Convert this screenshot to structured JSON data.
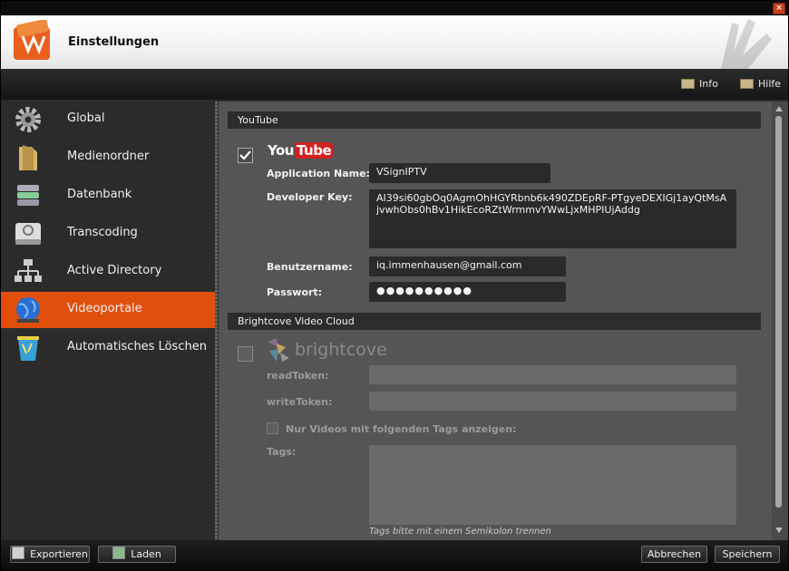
{
  "window": {
    "title": "Einstellungen",
    "close_glyph": "×"
  },
  "menu": {
    "info": "Info",
    "help": "Hilfe"
  },
  "sidebar": {
    "items": [
      {
        "label": "Global",
        "icon": "gear-icon"
      },
      {
        "label": "Medienordner",
        "icon": "folder-icon"
      },
      {
        "label": "Datenbank",
        "icon": "database-icon"
      },
      {
        "label": "Transcoding",
        "icon": "drive-icon"
      },
      {
        "label": "Active Directory",
        "icon": "network-icon"
      },
      {
        "label": "Videoportale",
        "icon": "globe-icon",
        "active": true
      },
      {
        "label": "Automatisches Löschen",
        "icon": "trash-icon"
      }
    ]
  },
  "youtube": {
    "section_title": "YouTube",
    "logo_you": "You",
    "logo_tube": "Tube",
    "enabled": true,
    "app_name_label": "Application Name:",
    "app_name_value": "VSignIPTV",
    "dev_key_label": "Developer Key:",
    "dev_key_value": "AI39si60gbOq0AgmOhHGYRbnb6k490ZDEpRF-PTgyeDEXIGj1ayQtMsAjvwhObs0hBv1HikEcoRZtWrmmvYWwLjxMHPIUjAddg",
    "username_label": "Benutzername:",
    "username_value": "iq.immenhausen@gmail.com",
    "password_label": "Passwort:",
    "password_value": "●●●●●●●●●●"
  },
  "brightcove": {
    "section_title": "Brightcove Video Cloud",
    "logo_text": "brightcove",
    "enabled": false,
    "read_token_label": "readToken:",
    "write_token_label": "writeToken:",
    "tags_filter_label": "Nur Videos mit folgenden Tags anzeigen:",
    "tags_label": "Tags:",
    "tags_hint": "Tags bitte mit einem Semikolon trennen"
  },
  "footer": {
    "export": "Exportieren",
    "load": "Laden",
    "cancel": "Abbrechen",
    "save": "Speichern"
  },
  "colors": {
    "accent": "#e04f0c",
    "panel": "#555555",
    "sidebar": "#2b2b2b"
  }
}
